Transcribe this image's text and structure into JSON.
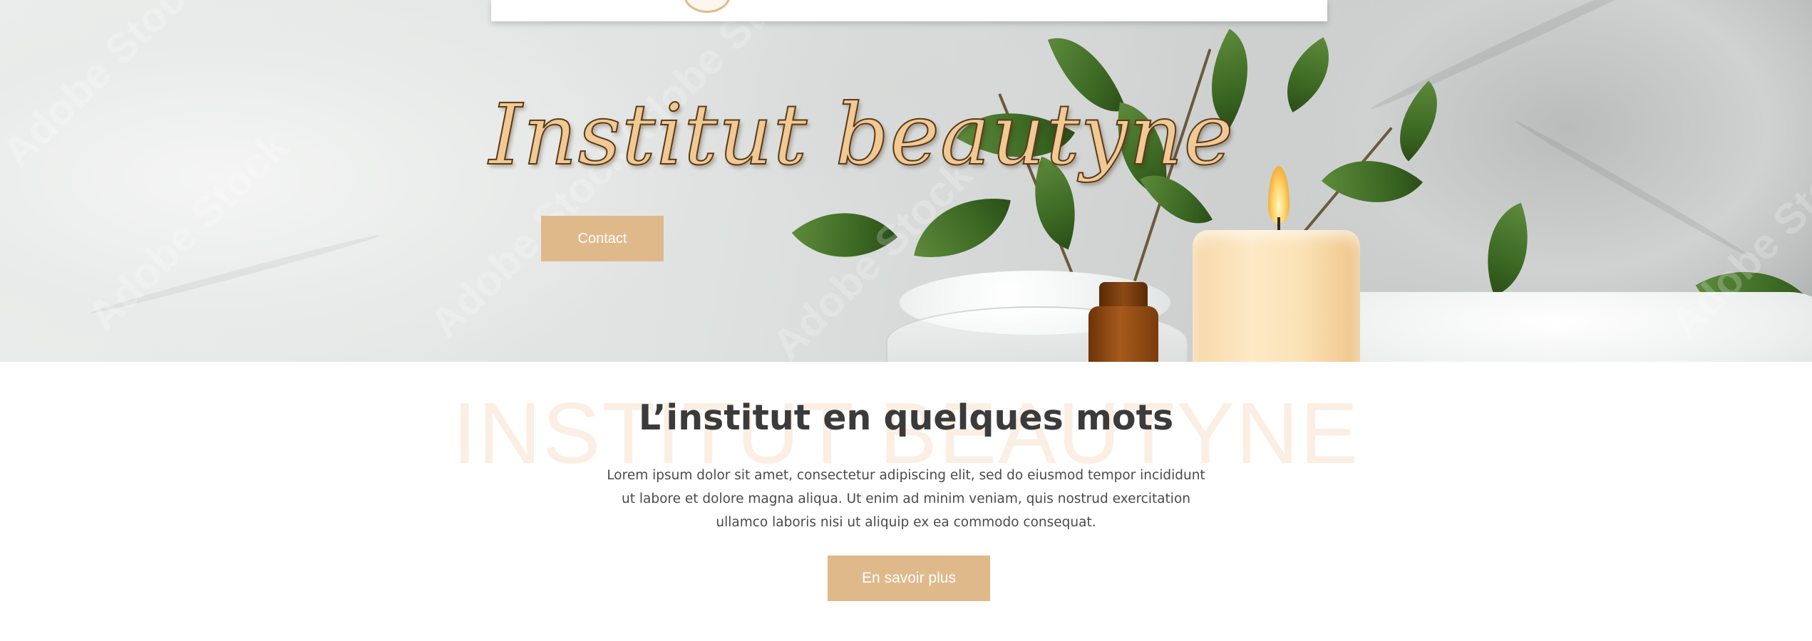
{
  "hero": {
    "title": "Institut beautyne",
    "contact_button": "Contact"
  },
  "intro": {
    "ghost_text": "INSTITUT BEAUTYNE",
    "heading": "L’institut en quelques mots",
    "paragraph": "Lorem ipsum dolor sit amet, consectetur adipiscing elit, sed do eiusmod tempor incididunt ut labore et dolore magna aliqua. Ut enim ad minim veniam, quis nostrud exercitation ullamco laboris nisi ut aliquip ex ea commodo consequat.",
    "more_button": "En savoir plus"
  },
  "colors": {
    "accent": "#e0b98b",
    "title_fill": "#f0c995",
    "heading_text": "#3b3b3b",
    "body_text": "#4a4a4a",
    "ghost_text": "#fbeee2"
  },
  "watermark": "Adobe Stock"
}
